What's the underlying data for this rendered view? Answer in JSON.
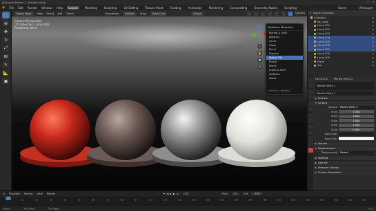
{
  "window": {
    "title": "[Unsaved] Blender [...\\Marbles.blend]"
  },
  "menu": {
    "items": [
      "File",
      "Edit",
      "Render",
      "Window",
      "Help"
    ],
    "workspaces": [
      "Layout",
      "Modeling",
      "Sculpting",
      "UV Editing",
      "Texture Paint",
      "Shading",
      "Animation",
      "Rendering",
      "Compositing",
      "Geometry Nodes",
      "Scripting"
    ],
    "active_workspace": "Layout",
    "scene": "Scene",
    "view_layer": "ViewLayer"
  },
  "viewport_header": {
    "editor": "Object Mode",
    "menus": [
      "View",
      "Select",
      "Add",
      "Object"
    ],
    "orientation_label": "Orientation:",
    "orientation": "Default",
    "drag": "Drag:",
    "drag_value": "Select Box",
    "pivot": "Global",
    "options": "Options"
  },
  "viewport_info": {
    "line1": "Camera Perspective",
    "line2": "(1) Collection | Lamp.003",
    "line3": "Rendering Done"
  },
  "popup": {
    "title": "Realtime Materials",
    "items": [
      "Marble & Stuff",
      "Abstract",
      "Carve",
      "Glass",
      "Metal",
      "Organic",
      "Plastic Tile",
      "Plastic",
      "Rocks",
      "Stone & Stuff",
      "Surfaces",
      "Wood"
    ],
    "active_index": 6,
    "footer": "material_category"
  },
  "outliner": {
    "header": "Scene Collection",
    "rows": [
      {
        "label": "Collection",
        "sel": false,
        "color": "#cccccc"
      },
      {
        "label": "Bk_Lamp",
        "sel": false,
        "color": "#e0a040"
      },
      {
        "label": "Lamp.001",
        "sel": false,
        "color": "#e0a040"
      },
      {
        "label": "Lamp.002",
        "sel": false,
        "color": "#e0a040"
      },
      {
        "label": "Lamp.003",
        "sel": false,
        "color": "#e0a040"
      },
      {
        "label": "Lamp.004",
        "sel": true,
        "color": "#e0a040"
      },
      {
        "label": "Lamp.005",
        "sel": true,
        "color": "#e0a040"
      },
      {
        "label": "Lamp.006",
        "sel": true,
        "color": "#e0a040"
      },
      {
        "label": "Lamp.007",
        "sel": true,
        "color": "#e0a040"
      },
      {
        "label": "Lamp.008",
        "sel": false,
        "color": "#e0a040"
      },
      {
        "label": "Lamp.009",
        "sel": false,
        "color": "#e0a040"
      },
      {
        "label": "Plane",
        "sel": false,
        "color": "#e0a040"
      },
      {
        "label": "Sun",
        "sel": false,
        "color": "#e0a040"
      }
    ]
  },
  "properties": {
    "object": "Lamp.002",
    "material": "Marble White 2",
    "slot": "Marble White 2",
    "sections": {
      "preview": "Preview",
      "surface": "Surface",
      "volume": "Volume",
      "displacement": "Displacement",
      "settings": "Settings",
      "lineart": "Line Art",
      "viewport": "Viewport Display",
      "custom": "Custom Properties"
    },
    "surface_label": "Surface",
    "surface_value": "Marble White 2",
    "fields": [
      {
        "label": "Scale",
        "value": "1.000"
      },
      {
        "label": "Scale",
        "value": "1.000"
      },
      {
        "label": "Scale",
        "value": "1.000"
      },
      {
        "label": "Scale",
        "value": "1.000"
      },
      {
        "label": "Scale",
        "value": "1.000"
      }
    ],
    "base_color_label": "Base Color",
    "base_color2_label": "Base Color",
    "displacement_label": "Displacement",
    "displacement_value": "Default"
  },
  "timeline": {
    "menus": [
      "Playback",
      "Keying",
      "View",
      "Marker"
    ],
    "current": "1",
    "start_label": "Start",
    "start": "1",
    "end_label": "End",
    "end": "250",
    "ticks": [
      "1",
      "10",
      "20",
      "30",
      "40",
      "50",
      "60",
      "70",
      "80",
      "90",
      "100",
      "110",
      "120",
      "130",
      "140",
      "150",
      "160",
      "170",
      "180",
      "190",
      "200",
      "210",
      "220",
      "230",
      "240",
      "250"
    ]
  },
  "status": {
    "select": "Select",
    "pan": "Pan View",
    "menu": "Call Menu",
    "version": "3.6.0"
  },
  "spheres": [
    {
      "color": "#c8281a",
      "accent": "#ff5030"
    },
    {
      "color": "#6b5a55",
      "accent": "#a08a84"
    },
    {
      "color": "#8a8a8a",
      "accent": "#e8e8e8"
    },
    {
      "color": "#d8d6d0",
      "accent": "#ffffff"
    }
  ]
}
